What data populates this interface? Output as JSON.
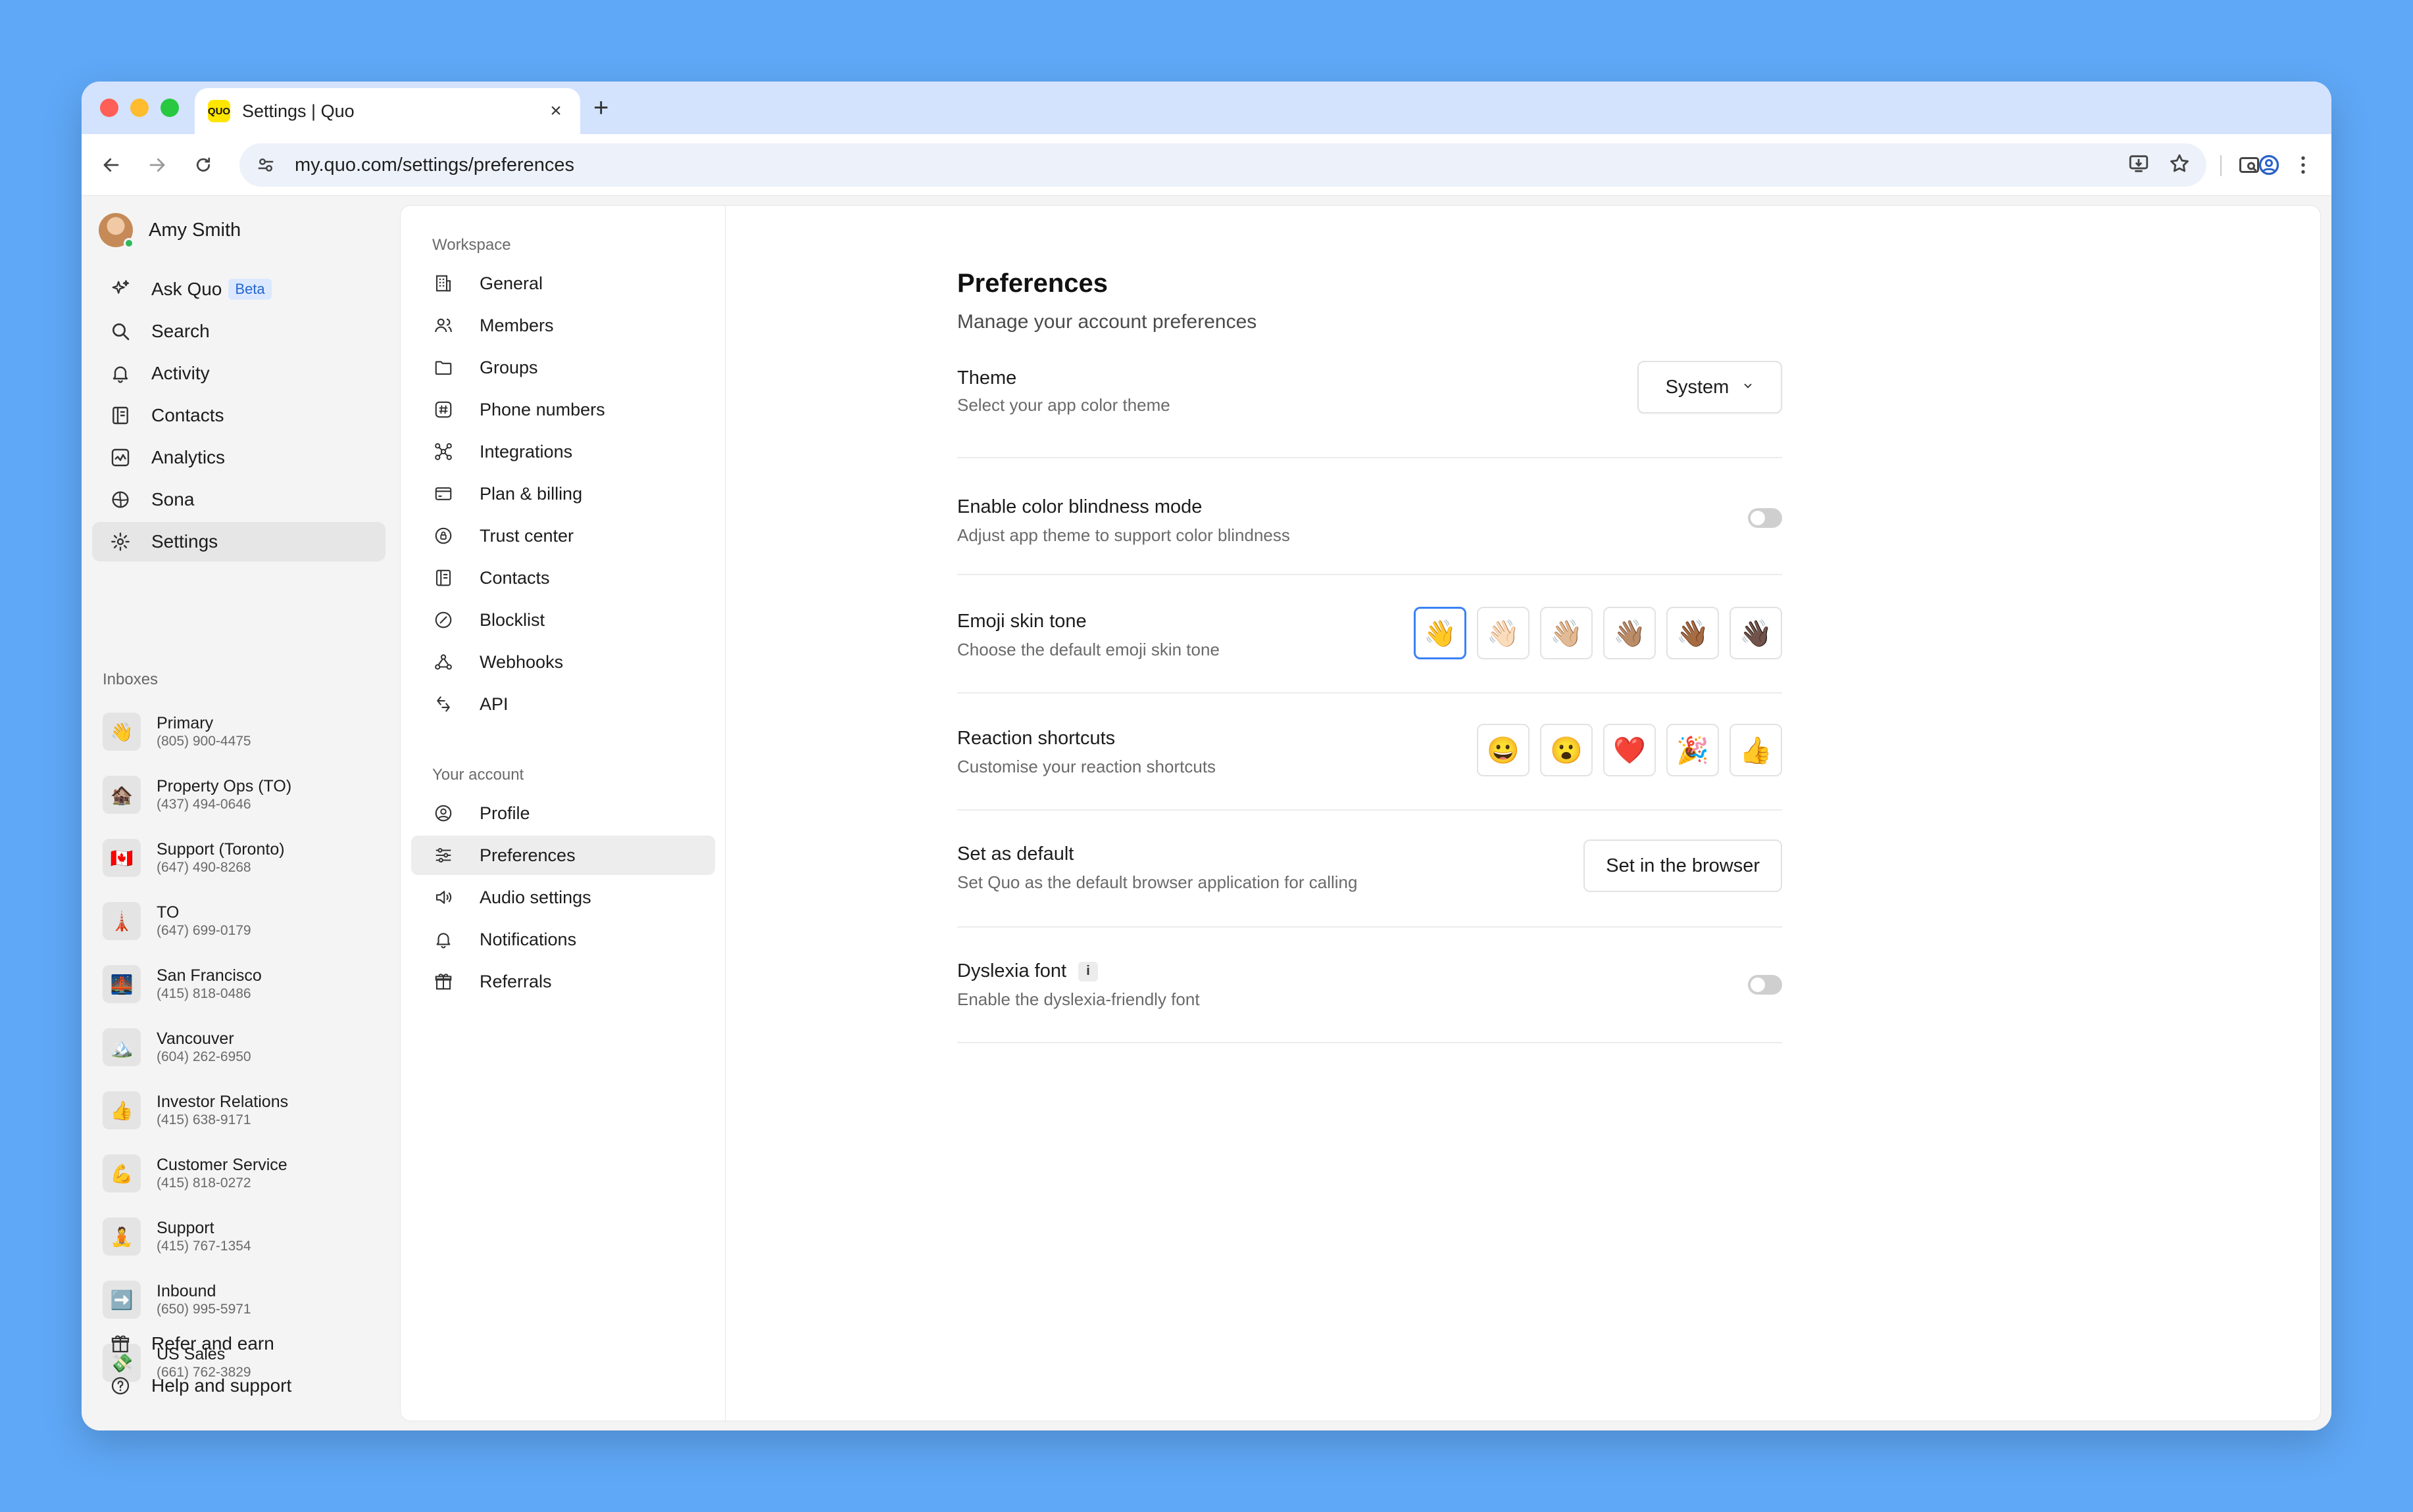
{
  "browser": {
    "tab_title": "Settings | Quo",
    "favicon_text": "QUO",
    "url": "my.quo.com/settings/preferences"
  },
  "sidebar": {
    "user_name": "Amy Smith",
    "nav": [
      {
        "label": "Ask Quo",
        "badge": "Beta",
        "icon": "sparkles-icon"
      },
      {
        "label": "Search",
        "icon": "search-icon"
      },
      {
        "label": "Activity",
        "icon": "bell-icon"
      },
      {
        "label": "Contacts",
        "icon": "contacts-icon"
      },
      {
        "label": "Analytics",
        "icon": "analytics-icon"
      },
      {
        "label": "Sona",
        "icon": "sona-icon"
      },
      {
        "label": "Settings",
        "icon": "gear-icon"
      }
    ],
    "inboxes_label": "Inboxes",
    "inboxes": [
      {
        "emoji": "👋",
        "name": "Primary",
        "phone": "(805) 900-4475"
      },
      {
        "emoji": "🏚️",
        "name": "Property Ops (TO)",
        "phone": "(437) 494-0646"
      },
      {
        "emoji": "🇨🇦",
        "name": "Support (Toronto)",
        "phone": "(647) 490-8268"
      },
      {
        "emoji": "🗼",
        "name": "TO",
        "phone": "(647) 699-0179"
      },
      {
        "emoji": "🌉",
        "name": "San Francisco",
        "phone": "(415) 818-0486"
      },
      {
        "emoji": "🏔️",
        "name": "Vancouver",
        "phone": "(604) 262-6950"
      },
      {
        "emoji": "👍",
        "name": "Investor Relations",
        "phone": "(415) 638-9171"
      },
      {
        "emoji": "💪",
        "name": "Customer Service",
        "phone": "(415) 818-0272"
      },
      {
        "emoji": "🧘",
        "name": "Support",
        "phone": "(415) 767-1354"
      },
      {
        "emoji": "➡️",
        "name": "Inbound",
        "phone": "(650) 995-5971"
      },
      {
        "emoji": "💸",
        "name": "US Sales",
        "phone": "(661) 762-3829"
      }
    ],
    "footer": [
      {
        "label": "Refer and earn",
        "icon": "gift-icon"
      },
      {
        "label": "Help and support",
        "icon": "help-icon"
      }
    ]
  },
  "settings_nav": {
    "workspace_label": "Workspace",
    "workspace": [
      {
        "label": "General",
        "icon": "building-icon"
      },
      {
        "label": "Members",
        "icon": "members-icon"
      },
      {
        "label": "Groups",
        "icon": "folder-icon"
      },
      {
        "label": "Phone numbers",
        "icon": "hash-icon"
      },
      {
        "label": "Integrations",
        "icon": "integrations-icon"
      },
      {
        "label": "Plan & billing",
        "icon": "card-icon"
      },
      {
        "label": "Trust center",
        "icon": "shield-icon"
      },
      {
        "label": "Contacts",
        "icon": "contacts-icon"
      },
      {
        "label": "Blocklist",
        "icon": "block-icon"
      },
      {
        "label": "Webhooks",
        "icon": "webhooks-icon"
      },
      {
        "label": "API",
        "icon": "api-icon"
      }
    ],
    "account_label": "Your account",
    "account": [
      {
        "label": "Profile",
        "icon": "profile-icon"
      },
      {
        "label": "Preferences",
        "icon": "sliders-icon"
      },
      {
        "label": "Audio settings",
        "icon": "speaker-icon"
      },
      {
        "label": "Notifications",
        "icon": "bell-icon"
      },
      {
        "label": "Referrals",
        "icon": "gift-icon"
      }
    ]
  },
  "preferences": {
    "title": "Preferences",
    "subtitle": "Manage your account preferences",
    "theme": {
      "title": "Theme",
      "desc": "Select your app color theme",
      "value": "System"
    },
    "color_blind": {
      "title": "Enable color blindness mode",
      "desc": "Adjust app theme to support color blindness",
      "enabled": false
    },
    "skin_tone": {
      "title": "Emoji skin tone",
      "desc": "Choose the default emoji skin tone",
      "options": [
        "👋",
        "👋🏻",
        "👋🏼",
        "👋🏽",
        "👋🏾",
        "👋🏿"
      ],
      "selected_index": 0
    },
    "reactions": {
      "title": "Reaction shortcuts",
      "desc": "Customise your reaction shortcuts",
      "options": [
        "😀",
        "😮",
        "❤️",
        "🎉",
        "👍"
      ]
    },
    "default_app": {
      "title": "Set as default",
      "desc": "Set Quo as the default browser application for calling",
      "button": "Set in the browser"
    },
    "dyslexia": {
      "title": "Dyslexia font",
      "info": "i",
      "desc": "Enable the dyslexia-friendly font",
      "enabled": false
    }
  },
  "colors": {
    "accent": "#3b82f6",
    "background": "#5fa8f7",
    "toggle_off": "#cfcfcf"
  }
}
